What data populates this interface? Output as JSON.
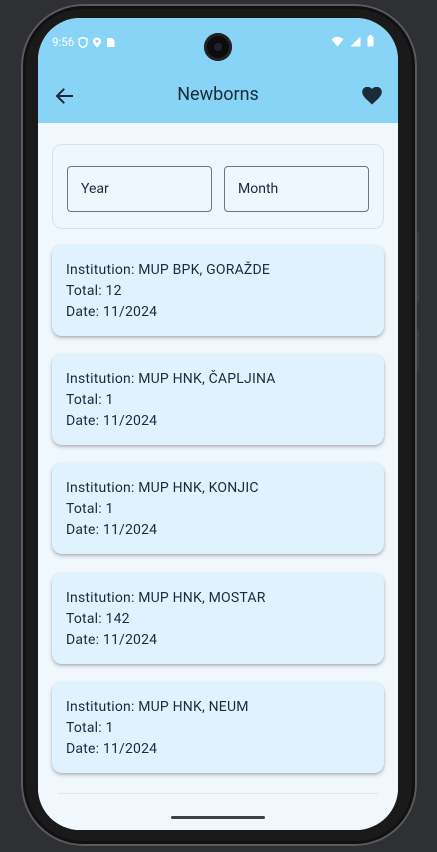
{
  "status_bar": {
    "time": "9:56",
    "left_icons": [
      "shield-icon",
      "location-icon",
      "sim-icon"
    ],
    "right_icons": [
      "wifi-icon",
      "signal-icon",
      "battery-icon"
    ]
  },
  "app_bar": {
    "title": "Newborns",
    "back_icon": "arrow-back-icon",
    "favorite_icon": "heart-icon"
  },
  "filters": {
    "year_placeholder": "Year",
    "month_placeholder": "Month"
  },
  "records": [
    {
      "institution": "Institution: MUP BPK, GORAŽDE",
      "total": "Total: 12",
      "date": "Date: 11/2024"
    },
    {
      "institution": "Institution: MUP HNK, ČAPLJINA",
      "total": "Total: 1",
      "date": "Date: 11/2024"
    },
    {
      "institution": "Institution: MUP HNK, KONJIC",
      "total": "Total: 1",
      "date": "Date: 11/2024"
    },
    {
      "institution": "Institution: MUP HNK, MOSTAR",
      "total": "Total: 142",
      "date": "Date: 11/2024"
    },
    {
      "institution": "Institution: MUP HNK, NEUM",
      "total": "Total: 1",
      "date": "Date: 11/2024"
    }
  ],
  "colors": {
    "app_bar": "#87d4f7",
    "background": "#f0f8fe",
    "card": "#dff2fd",
    "text": "#1c2b3a"
  }
}
